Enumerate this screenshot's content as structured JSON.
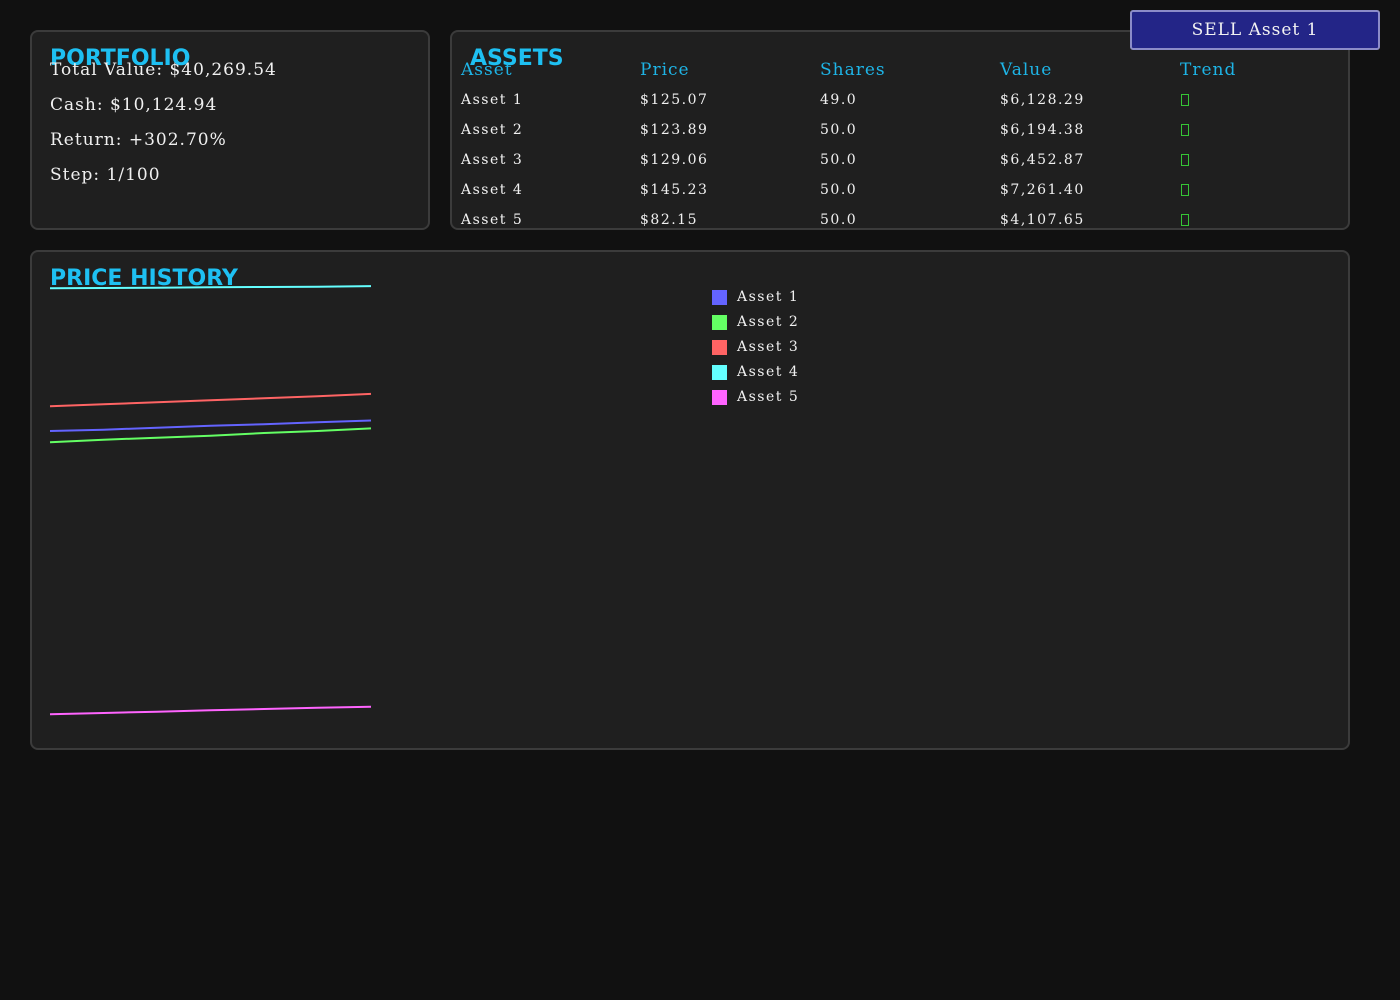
{
  "portfolio": {
    "title": "PORTFOLIO",
    "total_value": "Total Value: $40,269.54",
    "cash": "Cash: $10,124.94",
    "return": "Return: +302.70%",
    "step": "Step: 1/100"
  },
  "assets": {
    "title": "ASSETS",
    "columns": [
      "Asset",
      "Price",
      "Shares",
      "Value",
      "Trend"
    ],
    "rows": [
      {
        "asset": "Asset 1",
        "price": "$125.07",
        "shares": "49.0",
        "value": "$6,128.29",
        "trend": "up-icon"
      },
      {
        "asset": "Asset 2",
        "price": "$123.89",
        "shares": "50.0",
        "value": "$6,194.38",
        "trend": "up-icon"
      },
      {
        "asset": "Asset 3",
        "price": "$129.06",
        "shares": "50.0",
        "value": "$6,452.87",
        "trend": "up-icon"
      },
      {
        "asset": "Asset 4",
        "price": "$145.23",
        "shares": "50.0",
        "value": "$7,261.40",
        "trend": "up-icon"
      },
      {
        "asset": "Asset 5",
        "price": "$82.15",
        "shares": "50.0",
        "value": "$4,107.65",
        "trend": "up-icon"
      }
    ],
    "trend_color": "#35c435"
  },
  "actions": {
    "sell_label": "SELL Asset 1"
  },
  "price_history": {
    "title": "PRICE HISTORY"
  },
  "chart_data": {
    "type": "line",
    "title": "PRICE HISTORY",
    "xlabel": "",
    "ylabel": "",
    "grid": false,
    "legend_placement": "top-center",
    "x": [
      0,
      1,
      2,
      3,
      4,
      5,
      6
    ],
    "ylim": [
      80,
      146
    ],
    "series": [
      {
        "name": "Asset 1",
        "color": "#6464ff",
        "values": [
          123.5,
          123.7,
          124.0,
          124.3,
          124.5,
          124.8,
          125.07
        ]
      },
      {
        "name": "Asset 2",
        "color": "#64ff64",
        "values": [
          121.8,
          122.2,
          122.5,
          122.8,
          123.2,
          123.5,
          123.89
        ]
      },
      {
        "name": "Asset 3",
        "color": "#ff6464",
        "values": [
          127.2,
          127.5,
          127.8,
          128.1,
          128.4,
          128.7,
          129.06
        ]
      },
      {
        "name": "Asset 4",
        "color": "#64ffff",
        "values": [
          144.9,
          144.95,
          145.0,
          145.05,
          145.1,
          145.15,
          145.23
        ]
      },
      {
        "name": "Asset 5",
        "color": "#ff64ff",
        "values": [
          81.0,
          81.2,
          81.4,
          81.6,
          81.8,
          82.0,
          82.15
        ]
      }
    ]
  }
}
